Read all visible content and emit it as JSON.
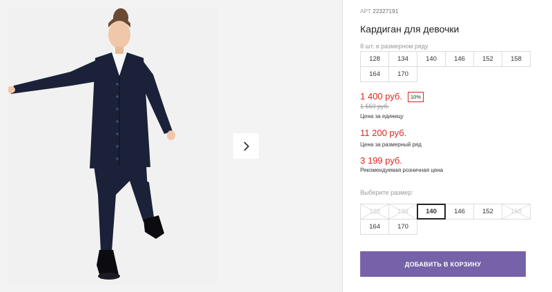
{
  "product": {
    "art_label": "АРТ",
    "art_number": "22327191",
    "title": "Кардиган для девочки",
    "qty_note": "8 шт. в размерном ряду"
  },
  "sizes_row_info": [
    "128",
    "134",
    "140",
    "146",
    "152",
    "158",
    "164",
    "170"
  ],
  "pricing": {
    "unit_price": "1 400 руб.",
    "discount_badge": "10%",
    "old_price": "1 550 руб.",
    "unit_caption": "Цена за единицу",
    "row_price": "11 200 руб.",
    "row_caption": "Цена за размерный ряд",
    "rrp_price": "3 199 руб.",
    "rrp_caption": "Рекомендуемая розничная цена"
  },
  "size_picker": {
    "label": "Выберите размер:",
    "options": [
      {
        "label": "128",
        "state": "disabled"
      },
      {
        "label": "134",
        "state": "disabled"
      },
      {
        "label": "140",
        "state": "selected"
      },
      {
        "label": "146",
        "state": "available"
      },
      {
        "label": "152",
        "state": "available"
      },
      {
        "label": "158",
        "state": "disabled"
      },
      {
        "label": "164",
        "state": "available"
      },
      {
        "label": "170",
        "state": "available"
      }
    ]
  },
  "cart": {
    "button_label": "ДОБАВИТЬ В КОРЗИНУ",
    "button_color": "#7562a8"
  },
  "gallery": {
    "next_icon": "chevron-right-icon",
    "photo_subject": "product-photo"
  },
  "colors": {
    "accent_red": "#e2231a",
    "garment_navy": "#1a2138"
  }
}
